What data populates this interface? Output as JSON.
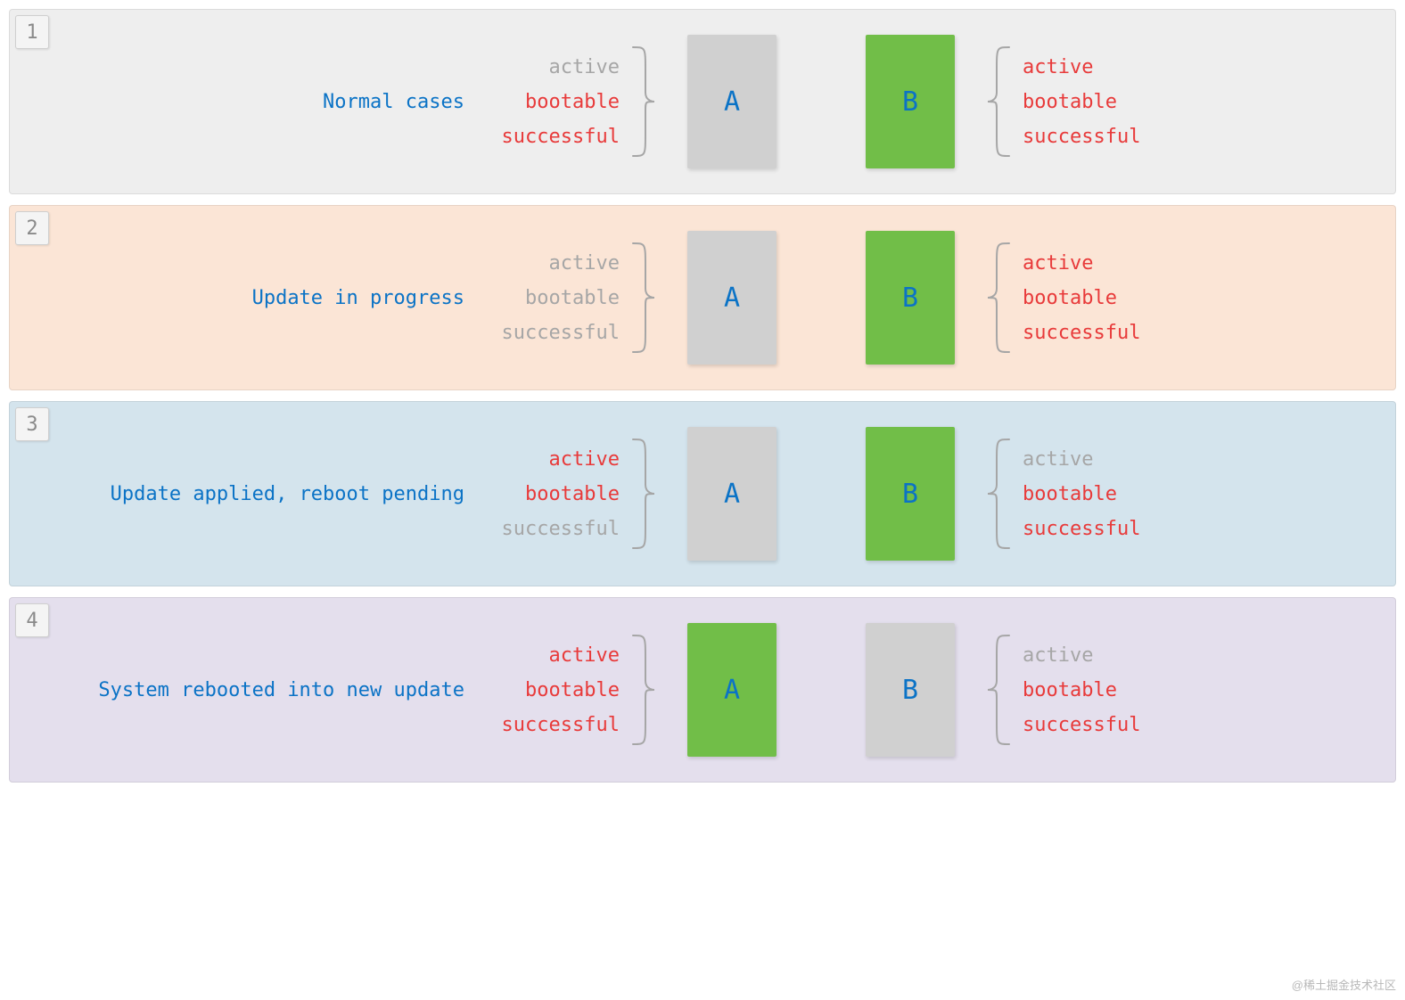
{
  "labels": {
    "active": "active",
    "bootable": "bootable",
    "successful": "successful",
    "slotA": "A",
    "slotB": "B"
  },
  "watermark": "@稀土掘金技术社区",
  "rows": [
    {
      "num": "1",
      "bg": "row-1",
      "title": "Normal cases",
      "left": {
        "active": "grey",
        "bootable": "red",
        "successful": "red"
      },
      "right": {
        "active": "red",
        "bootable": "red",
        "successful": "red"
      },
      "slotA": "grey",
      "slotB": "green"
    },
    {
      "num": "2",
      "bg": "row-2",
      "title": "Update in progress",
      "left": {
        "active": "grey",
        "bootable": "grey",
        "successful": "grey"
      },
      "right": {
        "active": "red",
        "bootable": "red",
        "successful": "red"
      },
      "slotA": "grey",
      "slotB": "green"
    },
    {
      "num": "3",
      "bg": "row-3",
      "title": "Update applied, reboot pending",
      "left": {
        "active": "red",
        "bootable": "red",
        "successful": "grey"
      },
      "right": {
        "active": "grey",
        "bootable": "red",
        "successful": "red"
      },
      "slotA": "grey",
      "slotB": "green"
    },
    {
      "num": "4",
      "bg": "row-4",
      "title": "System rebooted into new update",
      "left": {
        "active": "red",
        "bootable": "red",
        "successful": "red"
      },
      "right": {
        "active": "grey",
        "bootable": "red",
        "successful": "red"
      },
      "slotA": "green",
      "slotB": "grey"
    }
  ]
}
